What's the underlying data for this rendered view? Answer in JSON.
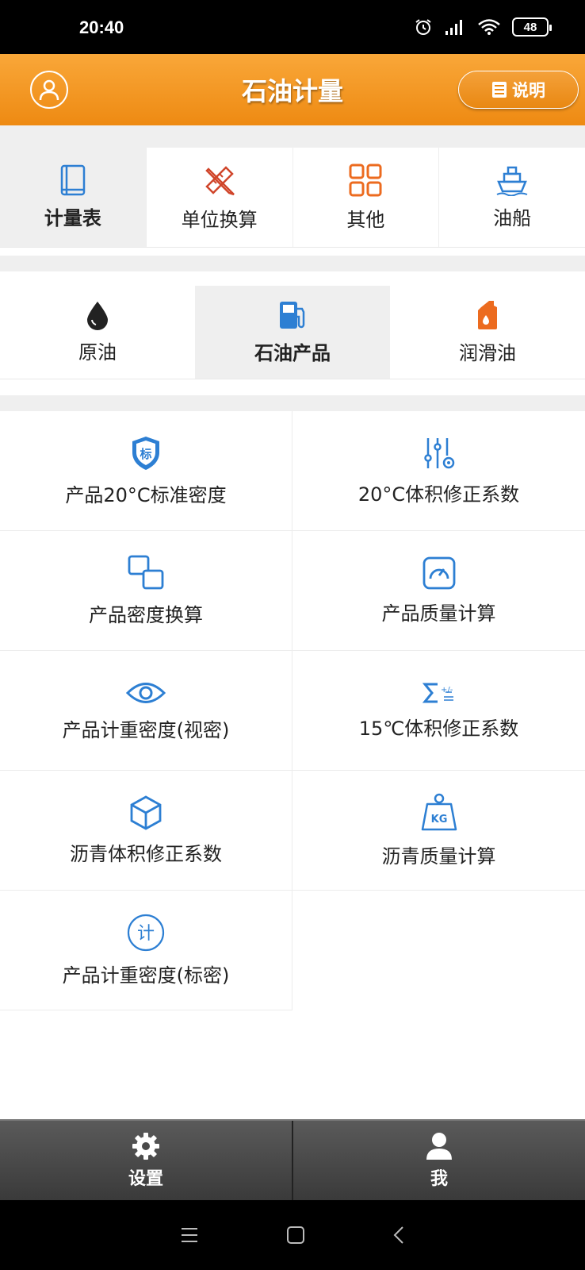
{
  "status": {
    "time": "20:40",
    "battery": "48"
  },
  "header": {
    "title": "石油计量",
    "help_label": "说明"
  },
  "tabs": [
    {
      "label": "计量表",
      "icon": "book-icon",
      "active": true
    },
    {
      "label": "单位换算",
      "icon": "ruler-pencil-icon",
      "active": false
    },
    {
      "label": "其他",
      "icon": "grid-icon",
      "active": false
    },
    {
      "label": "油船",
      "icon": "ship-icon",
      "active": false
    }
  ],
  "subtabs": [
    {
      "label": "原油",
      "icon": "oil-drop-icon",
      "active": false
    },
    {
      "label": "石油产品",
      "icon": "fuel-pump-icon",
      "active": true
    },
    {
      "label": "润滑油",
      "icon": "oil-can-icon",
      "active": false
    }
  ],
  "items": [
    {
      "label": "产品20°C标准密度",
      "icon": "shield-icon",
      "icon_text": "标"
    },
    {
      "label": "20°C体积修正系数",
      "icon": "sliders-icon"
    },
    {
      "label": "产品密度换算",
      "icon": "convert-icon"
    },
    {
      "label": "产品质量计算",
      "icon": "gauge-icon"
    },
    {
      "label": "产品计重密度(视密)",
      "icon": "eye-icon"
    },
    {
      "label": "15℃体积修正系数",
      "icon": "sigma-icon"
    },
    {
      "label": "沥青体积修正系数",
      "icon": "cube-icon"
    },
    {
      "label": "沥青质量计算",
      "icon": "weight-icon",
      "icon_text": "KG"
    },
    {
      "label": "产品计重密度(标密)",
      "icon": "calc-circle-icon",
      "icon_text": "计"
    }
  ],
  "bottom_nav": [
    {
      "label": "设置",
      "icon": "gear-icon"
    },
    {
      "label": "我",
      "icon": "user-icon"
    }
  ],
  "colors": {
    "accent": "#f39a26",
    "blue": "#2d7fd3",
    "orange_icon": "#ec6b1f"
  }
}
